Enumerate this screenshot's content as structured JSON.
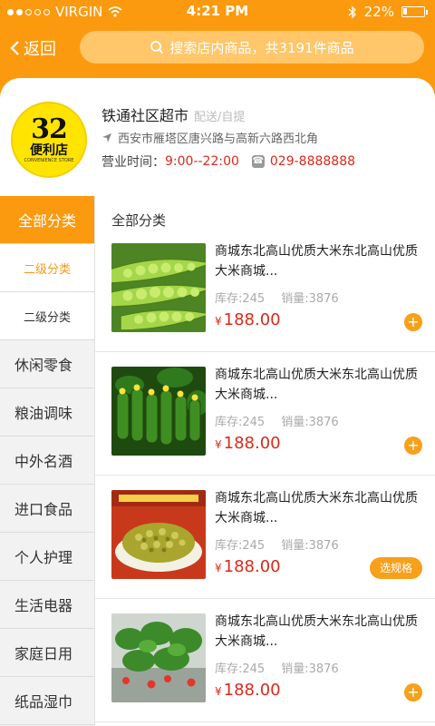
{
  "status_bar": {
    "carrier": "VIRGIN",
    "time": "4:21 PM",
    "battery": "22%"
  },
  "nav": {
    "back_label": "返回",
    "search_placeholder": "搜索店内商品，共3191件商品"
  },
  "store": {
    "logo_number": "32",
    "logo_name": "便利店",
    "logo_sub": "CONVENIENCE STORE",
    "name": "铁通社区超市",
    "delivery": "配送/自提",
    "address": "西安市雁塔区唐兴路与高新六路西北角",
    "hours_label": "营业时间：",
    "hours_value": "9:00--22:00",
    "phone": "029-8888888"
  },
  "sidebar": {
    "items": [
      {
        "label": "全部分类"
      },
      {
        "label": "二级分类"
      },
      {
        "label": "二级分类"
      },
      {
        "label": "休闲零食"
      },
      {
        "label": "粮油调味"
      },
      {
        "label": "中外名酒"
      },
      {
        "label": "进口食品"
      },
      {
        "label": "个人护理"
      },
      {
        "label": "生活电器"
      },
      {
        "label": "家庭日用"
      },
      {
        "label": "纸品湿巾"
      }
    ]
  },
  "content": {
    "section_title": "全部分类",
    "products": [
      {
        "title": "商城东北高山优质大米东北高山优质大米商城...",
        "stock": "库存:245",
        "sales": "销量:3876",
        "currency": "¥",
        "price": "188.00",
        "action": "+",
        "image": "green-peas"
      },
      {
        "title": "商城东北高山优质大米东北高山优质大米商城...",
        "stock": "库存:245",
        "sales": "销量:3876",
        "currency": "¥",
        "price": "188.00",
        "action": "+",
        "image": "cucumbers"
      },
      {
        "title": "商城东北高山优质大米东北高山优质大米商城...",
        "stock": "库存:245",
        "sales": "销量:3876",
        "currency": "¥",
        "price": "188.00",
        "action": "选规格",
        "image": "pickled-vegetables"
      },
      {
        "title": "商城东北高山优质大米东北高山优质大米商城...",
        "stock": "库存:245",
        "sales": "销量:3876",
        "currency": "¥",
        "price": "188.00",
        "action": "+",
        "image": "strawberry-plants"
      }
    ]
  },
  "colors": {
    "accent": "#fb9a0e",
    "price": "#d92a1c"
  }
}
